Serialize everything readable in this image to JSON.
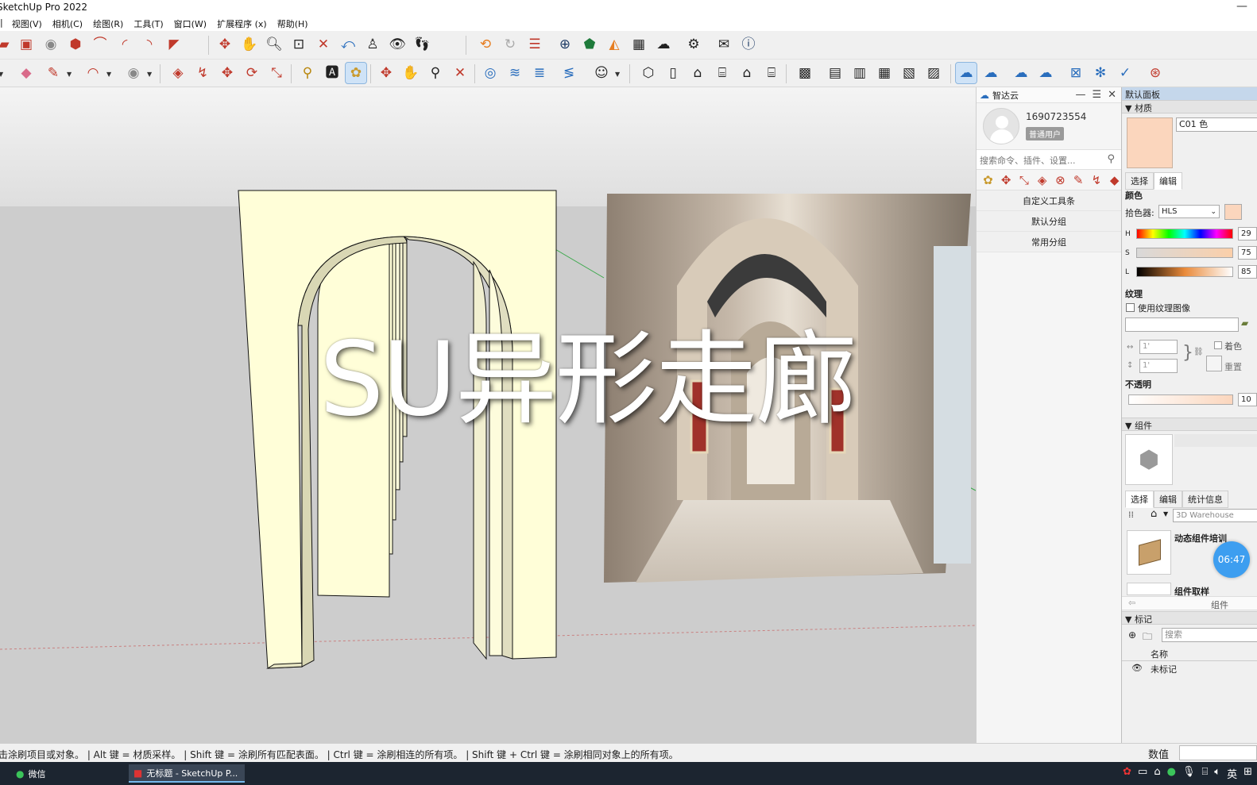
{
  "window": {
    "title": "SketchUp Pro 2022",
    "min_glyph": "—"
  },
  "menu": [
    "视图(V)",
    "相机(C)",
    "绘图(R)",
    "工具(T)",
    "窗口(W)",
    "扩展程序 (x)",
    "帮助(H)"
  ],
  "menu_prefix": "|",
  "overlay": {
    "title": "SU异形走廊"
  },
  "zhidayun": {
    "name": "智达云",
    "user_id": "1690723554",
    "badge": "普通用户",
    "search_placeholder": "搜索命令、插件、设置...",
    "groups": [
      "自定义工具条",
      "默认分组",
      "常用分组"
    ]
  },
  "tray": {
    "title": "默认面板",
    "materials": {
      "header": "▼ 材质",
      "name": "C01 色",
      "swatch_color": "#fbd6bd",
      "tabs": [
        "选择",
        "编辑"
      ],
      "color_label": "颜色",
      "picker_label": "拾色器:",
      "picker_value": "HLS",
      "h_label": "H",
      "h_value": "29",
      "s_label": "S",
      "s_value": "75",
      "l_label": "L",
      "l_value": "85",
      "texture_label": "纹理",
      "use_texture": "使用纹理图像",
      "dim1": "1'",
      "dim2": "1'",
      "tint": "着色",
      "reset": "重置",
      "opacity_label": "不透明",
      "opacity_value": "10"
    },
    "components": {
      "header": "▼ 组件",
      "tabs": [
        "选择",
        "编辑",
        "统计信息"
      ],
      "warehouse": "3D Warehouse",
      "item1": "动态组件培训",
      "item2": "组件取样",
      "footer": "组件"
    },
    "tags": {
      "header": "▼ 标记",
      "search_placeholder": "搜索",
      "col_name": "名称",
      "row1": "未标记"
    }
  },
  "status": {
    "message": "击涂刷项目或对象。 | Alt 键 = 材质采样。 | Shift 键 = 涂刷所有匹配表面。 | Ctrl 键 = 涂刷相连的所有项。 | Shift 键 + Ctrl 键 = 涂刷相同对象上的所有项。",
    "value_label": "数值"
  },
  "taskbar": {
    "items": [
      "微信",
      "无标题 - SketchUp P..."
    ],
    "ime": "英"
  },
  "timer": "06:47",
  "colors": {
    "accent": "#3d9ef0",
    "arch_fill": "#fffed8",
    "viewport_bg": "#cfcfcf"
  }
}
